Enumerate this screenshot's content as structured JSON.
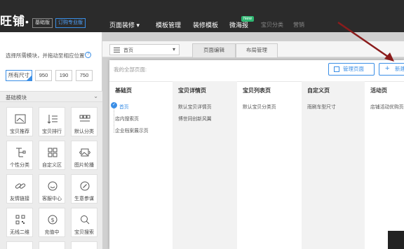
{
  "topbar": {
    "logo": "旺铺",
    "logo_dot": "•",
    "basic_badge": "基础版",
    "pro_badge": "订购专业版",
    "nav": [
      {
        "label": "页面装修",
        "chevron": "▾"
      },
      {
        "label": "模板管理"
      },
      {
        "label": "装修模板"
      },
      {
        "label": "微海报",
        "badge": "New"
      },
      {
        "label": "宝贝分类"
      },
      {
        "label": "营销"
      }
    ]
  },
  "left_panel": {
    "instruction": "选择所需模块，并拖动至相应位置",
    "help_icon": "question-circle-icon",
    "sizes": [
      "所有尺寸",
      "950",
      "190",
      "750"
    ],
    "selected_size": "所有尺寸",
    "category": {
      "label": "基础模块",
      "chevron": "⌄"
    },
    "modules": [
      {
        "label": "宝贝推荐",
        "icon": "image-frame-icon"
      },
      {
        "label": "宝贝排行",
        "icon": "sort-list-icon"
      },
      {
        "label": "默认分类",
        "icon": "grid-category-icon"
      },
      {
        "label": "个性分类",
        "icon": "custom-category-icon"
      },
      {
        "label": "自定义区",
        "icon": "four-squares-icon"
      },
      {
        "label": "图片轮播",
        "icon": "image-carousel-icon"
      },
      {
        "label": "友情链接",
        "icon": "link-chain-icon"
      },
      {
        "label": "客服中心",
        "icon": "customer-service-icon"
      },
      {
        "label": "生意参谋",
        "icon": "compass-icon"
      },
      {
        "label": "无线二维",
        "icon": "qr-code-icon"
      },
      {
        "label": "充值中",
        "icon": "recharge-coin-icon"
      },
      {
        "label": "宝贝搜索",
        "icon": "search-icon"
      }
    ]
  },
  "main": {
    "page_selector": {
      "value": "首页",
      "icon": "hamburger-icon",
      "chevron": "▾"
    },
    "tabs": [
      {
        "label": "页面编辑",
        "active": true
      },
      {
        "label": "布局管理",
        "active": false
      }
    ],
    "popup": {
      "title": "我的全部页面:",
      "manage_button": "管理页面",
      "create_button": {
        "plus": "+",
        "label": "新建"
      },
      "columns": [
        {
          "header": "基础页",
          "items": [
            "首页",
            "店内搜索页",
            "企业档案展示页"
          ],
          "shaded": false
        },
        {
          "header": "宝贝详情页",
          "items": [
            "默认宝贝详情页",
            "博世同创新风翼"
          ],
          "shaded": true
        },
        {
          "header": "宝贝列表页",
          "items": [
            "默认宝贝分类页"
          ],
          "shaded": false
        },
        {
          "header": "自定义页",
          "items": [
            "雨刷车型尺寸"
          ],
          "shaded": true
        },
        {
          "header": "活动页",
          "items": [
            "店铺活动优购页"
          ],
          "shaded": false
        }
      ],
      "selected_item": "首页"
    }
  },
  "colors": {
    "accent": "#3a8ee6",
    "topbar": "#2b2b2b",
    "new_badge": "#2eb872",
    "arrow": "#8b1c1c"
  }
}
